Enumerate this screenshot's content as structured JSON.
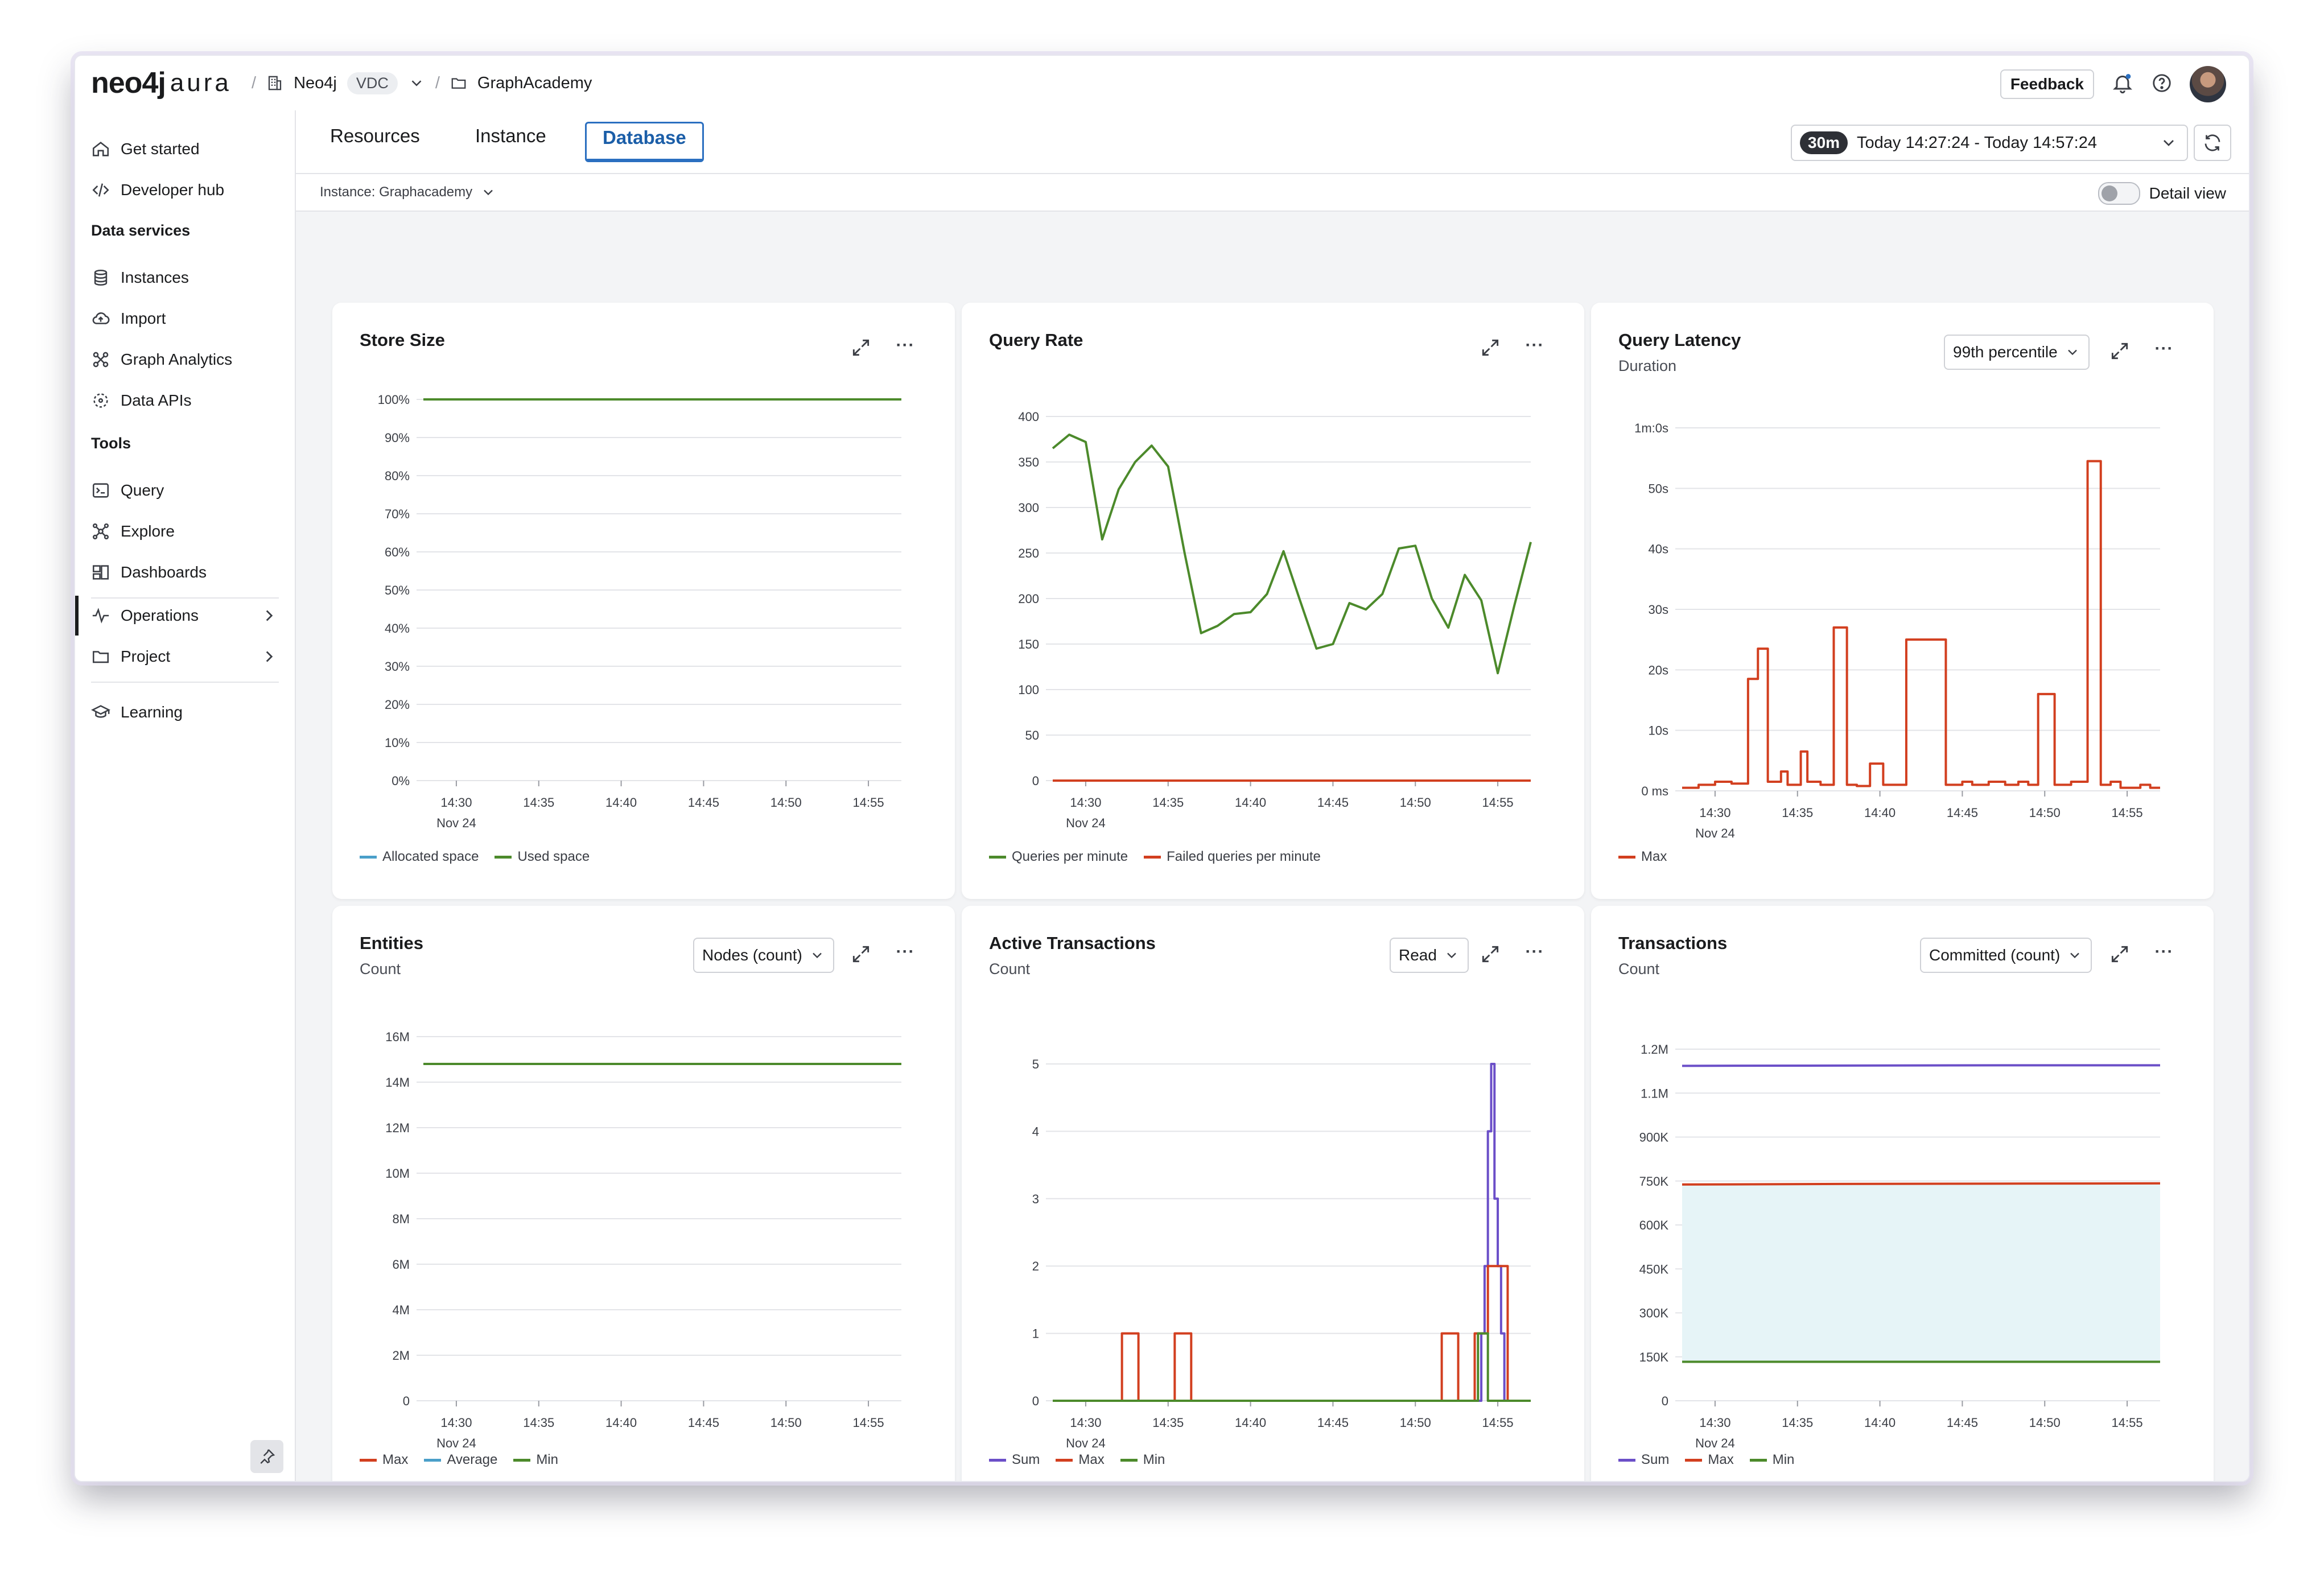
{
  "app": {
    "logo_main": "neo4j",
    "logo_sub": "aura",
    "org": "Neo4j",
    "org_chip": "VDC",
    "project": "GraphAcademy",
    "feedback_label": "Feedback"
  },
  "sidebar": {
    "items_top": [
      {
        "label": "Get started",
        "icon": "home-icon"
      },
      {
        "label": "Developer hub",
        "icon": "code-icon"
      }
    ],
    "section_data": "Data services",
    "items_data": [
      {
        "label": "Instances",
        "icon": "database-icon"
      },
      {
        "label": "Import",
        "icon": "cloud-upload-icon"
      },
      {
        "label": "Graph Analytics",
        "icon": "graph-analytics-icon"
      },
      {
        "label": "Data APIs",
        "icon": "data-api-icon"
      }
    ],
    "section_tools": "Tools",
    "items_tools": [
      {
        "label": "Query",
        "icon": "terminal-icon"
      },
      {
        "label": "Explore",
        "icon": "explore-icon"
      },
      {
        "label": "Dashboards",
        "icon": "dashboard-icon"
      }
    ],
    "items_nav": [
      {
        "label": "Operations",
        "icon": "pulse-icon",
        "active": true
      },
      {
        "label": "Project",
        "icon": "folder-icon"
      }
    ],
    "item_learning": {
      "label": "Learning",
      "icon": "graduation-cap-icon"
    }
  },
  "main": {
    "tabs": [
      "Resources",
      "Instance",
      "Database"
    ],
    "active_tab": "Database",
    "time_badge": "30m",
    "time_range": "Today 14:27:24 - Today 14:57:24",
    "instance_select": "Instance: Graphacademy",
    "detail_view_label": "Detail view"
  },
  "cards": [
    {
      "title": "Store Size",
      "subtitle": "",
      "dropdown": "",
      "legend": [
        {
          "label": "Allocated space",
          "color": "#4a9fc9"
        },
        {
          "label": "Used space",
          "color": "#4c8a2b"
        }
      ]
    },
    {
      "title": "Query Rate",
      "subtitle": "",
      "dropdown": "",
      "legend": [
        {
          "label": "Queries per minute",
          "color": "#4c8a2b"
        },
        {
          "label": "Failed queries per minute",
          "color": "#d23f1f"
        }
      ]
    },
    {
      "title": "Query Latency",
      "subtitle": "Duration",
      "dropdown": "99th percentile",
      "legend": [
        {
          "label": "Max",
          "color": "#d23f1f"
        }
      ]
    },
    {
      "title": "Entities",
      "subtitle": "Count",
      "dropdown": "Nodes (count)",
      "legend": [
        {
          "label": "Max",
          "color": "#d23f1f"
        },
        {
          "label": "Average",
          "color": "#4a9fc9"
        },
        {
          "label": "Min",
          "color": "#4c8a2b"
        }
      ]
    },
    {
      "title": "Active Transactions",
      "subtitle": "Count",
      "dropdown": "Read",
      "legend": [
        {
          "label": "Sum",
          "color": "#6b4fc8"
        },
        {
          "label": "Max",
          "color": "#d23f1f"
        },
        {
          "label": "Min",
          "color": "#4c8a2b"
        }
      ]
    },
    {
      "title": "Transactions",
      "subtitle": "Count",
      "dropdown": "Committed (count)",
      "legend": [
        {
          "label": "Sum",
          "color": "#6b4fc8"
        },
        {
          "label": "Max",
          "color": "#d23f1f"
        },
        {
          "label": "Min",
          "color": "#4c8a2b"
        }
      ]
    }
  ],
  "chart_data": [
    {
      "type": "line",
      "title": "Store Size",
      "yticks": [
        "100%",
        "90%",
        "80%",
        "70%",
        "60%",
        "50%",
        "40%",
        "30%",
        "20%",
        "10%",
        "0%"
      ],
      "ylim": [
        0,
        100
      ],
      "xticks": [
        "14:30",
        "14:35",
        "14:40",
        "14:45",
        "14:50",
        "14:55"
      ],
      "xdate": "Nov 24",
      "x_range": [
        "14:28:00",
        "14:57:00"
      ],
      "series": [
        {
          "name": "Allocated space",
          "color": "#4a9fc9",
          "y": [
            100,
            100
          ]
        },
        {
          "name": "Used space",
          "color": "#4c8a2b",
          "y": [
            100,
            100
          ]
        }
      ]
    },
    {
      "type": "line",
      "title": "Query Rate",
      "yticks": [
        "400",
        "350",
        "300",
        "250",
        "200",
        "150",
        "100",
        "50",
        "0"
      ],
      "ylim": [
        0,
        400
      ],
      "xticks": [
        "14:30",
        "14:35",
        "14:40",
        "14:45",
        "14:50",
        "14:55"
      ],
      "xdate": "Nov 24",
      "x_range": [
        "14:28:00",
        "14:57:00"
      ],
      "series": [
        {
          "name": "Queries per minute",
          "color": "#4c8a2b",
          "y": [
            365,
            380,
            372,
            265,
            320,
            350,
            368,
            345,
            250,
            162,
            170,
            183,
            185,
            205,
            252,
            198,
            145,
            150,
            195,
            188,
            205,
            255,
            258,
            200,
            168,
            226,
            198,
            118,
            192,
            262
          ]
        },
        {
          "name": "Failed queries per minute",
          "color": "#d23f1f",
          "y": [
            0,
            0,
            0,
            0,
            0,
            0,
            0,
            0,
            0,
            0,
            0,
            0,
            0,
            0,
            0,
            0,
            0,
            0,
            0,
            0,
            0,
            0,
            0,
            0,
            0,
            0,
            0,
            0,
            0,
            0
          ]
        }
      ]
    },
    {
      "type": "line",
      "title": "Query Latency",
      "step": true,
      "yticks": [
        "1m:0s",
        "50s",
        "40s",
        "30s",
        "20s",
        "10s",
        "0 ms"
      ],
      "ylim": [
        0,
        60
      ],
      "xticks": [
        "14:30",
        "14:35",
        "14:40",
        "14:45",
        "14:50",
        "14:55"
      ],
      "xdate": "Nov 24",
      "x_range": [
        "14:28:00",
        "14:57:00"
      ],
      "series": [
        {
          "name": "Max",
          "color": "#d23f1f",
          "x": [
            0,
            1,
            2,
            3,
            4,
            4.6,
            5.2,
            6.0,
            6.4,
            7.2,
            7.6,
            8.4,
            9.2,
            10.0,
            10.6,
            11.4,
            12.2,
            12.8,
            13.6,
            14.8,
            16.0,
            17.0,
            17.6,
            18.6,
            19.6,
            20.4,
            21.0,
            21.6,
            22.6,
            23.6,
            24.6,
            25.4,
            26.0,
            26.6,
            27.8,
            28.4,
            29.0
          ],
          "y": [
            0.5,
            1.0,
            1.5,
            1.2,
            18.5,
            23.5,
            1.5,
            3.2,
            1.0,
            6.5,
            1.5,
            1.0,
            27.0,
            1.0,
            0.8,
            4.5,
            1.0,
            1.0,
            25.0,
            25.0,
            1.0,
            1.5,
            1.0,
            1.5,
            1.0,
            1.5,
            1.0,
            16.0,
            1.0,
            1.5,
            54.5,
            1.0,
            1.5,
            0.5,
            1.0,
            0.5,
            0.5
          ]
        }
      ]
    },
    {
      "type": "line",
      "title": "Entities",
      "yticks": [
        "16M",
        "14M",
        "12M",
        "10M",
        "8M",
        "6M",
        "4M",
        "2M",
        "0"
      ],
      "ylim": [
        0,
        16000000
      ],
      "xticks": [
        "14:30",
        "14:35",
        "14:40",
        "14:45",
        "14:50",
        "14:55"
      ],
      "xdate": "Nov 24",
      "x_range": [
        "14:28:00",
        "14:57:00"
      ],
      "series": [
        {
          "name": "Max",
          "color": "#d23f1f",
          "y": [
            14800000,
            14800000
          ]
        },
        {
          "name": "Average",
          "color": "#4a9fc9",
          "y": [
            14800000,
            14800000
          ]
        },
        {
          "name": "Min",
          "color": "#4c8a2b",
          "y": [
            14800000,
            14800000
          ]
        }
      ]
    },
    {
      "type": "line",
      "title": "Active Transactions",
      "step": true,
      "yticks": [
        "5",
        "4",
        "3",
        "2",
        "1",
        "0"
      ],
      "ylim": [
        0,
        5
      ],
      "xticks": [
        "14:30",
        "14:35",
        "14:40",
        "14:45",
        "14:50",
        "14:55"
      ],
      "xdate": "Nov 24",
      "x_range": [
        "14:28:00",
        "14:57:00"
      ],
      "series": [
        {
          "name": "Sum",
          "color": "#6b4fc8",
          "x": [
            0,
            26.0,
            26.2,
            26.4,
            26.6,
            26.8,
            27.0,
            27.2,
            27.4,
            29.0
          ],
          "y": [
            0,
            1,
            2,
            4,
            5,
            3,
            2,
            1,
            0,
            0
          ]
        },
        {
          "name": "Max",
          "color": "#d23f1f",
          "x": [
            0,
            4.2,
            5.2,
            7.4,
            8.4,
            23.6,
            24.6,
            25.6,
            26.4,
            26.8,
            27.6,
            29.0
          ],
          "y": [
            0,
            1,
            0,
            1,
            0,
            1,
            0,
            1,
            2,
            2,
            0,
            0
          ]
        },
        {
          "name": "Min",
          "color": "#4c8a2b",
          "x": [
            0,
            25.8,
            26.4,
            29.0
          ],
          "y": [
            0,
            1,
            0,
            0
          ]
        }
      ]
    },
    {
      "type": "area",
      "title": "Transactions",
      "yticks": [
        "1.2M",
        "1.1M",
        "900K",
        "750K",
        "600K",
        "450K",
        "300K",
        "150K",
        "0"
      ],
      "yvalues": [
        1200000,
        1050000,
        900000,
        750000,
        600000,
        450000,
        300000,
        150000,
        0
      ],
      "ylim": [
        0,
        1200000
      ],
      "xticks": [
        "14:30",
        "14:35",
        "14:40",
        "14:45",
        "14:50",
        "14:55"
      ],
      "xdate": "Nov 24",
      "x_range": [
        "14:28:00",
        "14:57:00"
      ],
      "band_color": "#e6f4f7",
      "series": [
        {
          "name": "Sum",
          "color": "#6b4fc8",
          "y": [
            1143000,
            1144000,
            1145000,
            1145000
          ]
        },
        {
          "name": "Max",
          "color": "#d23f1f",
          "y": [
            738000,
            740000,
            741000,
            742000
          ]
        },
        {
          "name": "Min",
          "color": "#4c8a2b",
          "y": [
            133000,
            133000,
            133000,
            133000
          ]
        }
      ]
    }
  ]
}
